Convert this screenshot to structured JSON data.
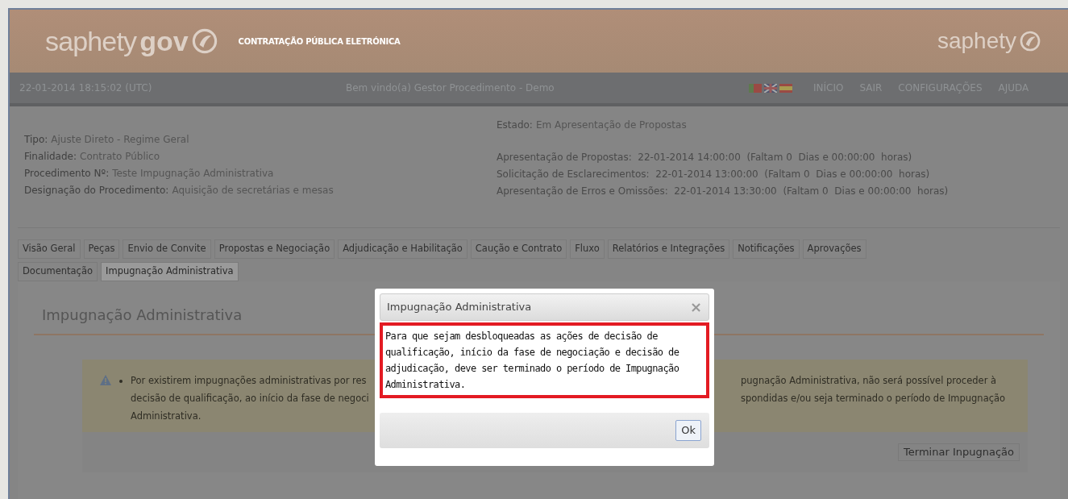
{
  "header": {
    "logo_light": "saphety",
    "logo_bold": "gov",
    "subtitle": "CONTRATAÇÃO PÚBLICA ELETRÓNICA",
    "right_logo": "saphety"
  },
  "nav": {
    "datetime": "22-01-2014 18:15:02 (UTC)",
    "welcome": "Bem vindo(a) Gestor Procedimento - Demo",
    "links": [
      "INÍCIO",
      "SAIR",
      "CONFIGURAÇÕES",
      "AJUDA"
    ]
  },
  "info": [
    {
      "label": "Tipo:",
      "value": "Ajuste Direto - Regime Geral"
    },
    {
      "label": "Finalidade:",
      "value": "Contrato Público"
    },
    {
      "label": "Procedimento Nº:",
      "value": "Teste Impugnação Administrativa"
    },
    {
      "label": "Designação do Procedimento:",
      "value": "Aquisição de secretárias e mesas"
    }
  ],
  "estado": {
    "label": "Estado:",
    "value": "Em Apresentação de Propostas"
  },
  "deadlines": [
    "Apresentação de Propostas:  22-01-2014 14:00:00  (Faltam 0  Dias e 00:00:00  horas)",
    "Solicitação de Esclarecimentos:  22-01-2014 13:00:00  (Faltam 0  Dias e 00:00:00  horas)",
    "Apresentação de Erros e Omissões:  22-01-2014 13:30:00  (Faltam 0  Dias e 00:00:00  horas)"
  ],
  "tabs": [
    [
      {
        "label": "Visão Geral",
        "selected": false
      },
      {
        "label": "Peças",
        "selected": false
      },
      {
        "label": "Envio de Convite",
        "selected": false
      },
      {
        "label": "Propostas e Negociação",
        "selected": false
      },
      {
        "label": "Adjudicação e Habilitação",
        "selected": false
      },
      {
        "label": "Caução e Contrato",
        "selected": false
      },
      {
        "label": "Fluxo",
        "selected": false
      },
      {
        "label": "Relatórios e Integrações",
        "selected": false
      },
      {
        "label": "Notificações",
        "selected": false
      },
      {
        "label": "Aprovações",
        "selected": false
      }
    ],
    [
      {
        "label": "Documentação",
        "selected": false
      },
      {
        "label": "Impugnação Administrativa",
        "selected": true
      }
    ]
  ],
  "section_title": "Impugnação Administrativa",
  "warning": {
    "left_lines": [
      "Por existirem impugnações administrativas por res",
      "decisão de qualificação, ao início da fase de negoci",
      "Administrativa."
    ],
    "right_lines": [
      "pugnação Administrativa, não será possível proceder à",
      "spondidas e/ou seja terminado o período de Impugnação"
    ]
  },
  "action_button": "Terminar Inpugnação",
  "dialog": {
    "title": "Impugnação Administrativa",
    "close": "×",
    "message": "Para que sejam desbloqueadas as ações de decisão de qualificação, início da fase de negociação e decisão de adjudicação, deve ser terminado o período de Impugnação Administrativa.",
    "button": "Ok"
  }
}
